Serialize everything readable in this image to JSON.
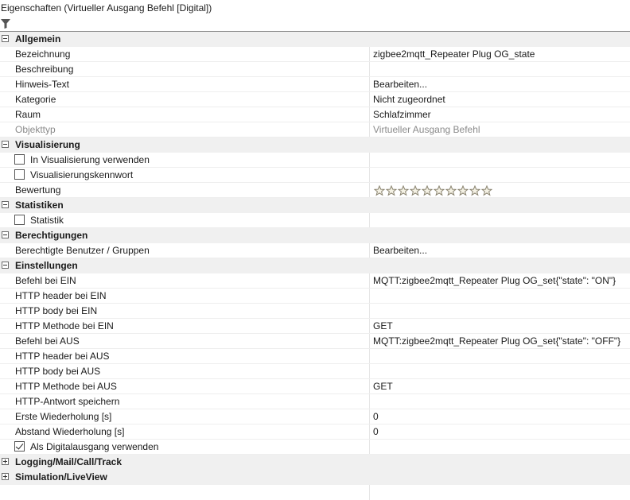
{
  "window": {
    "title": "Eigenschaften (Virtueller Ausgang Befehl [Digital])"
  },
  "toolbar": {
    "filter_icon": "filter-icon"
  },
  "rows": [
    {
      "kind": "category",
      "label": "Allgemein",
      "expanded": true
    },
    {
      "kind": "property",
      "label": "Bezeichnung",
      "value": "zigbee2mqtt_Repeater Plug OG_state"
    },
    {
      "kind": "property",
      "label": "Beschreibung",
      "value": ""
    },
    {
      "kind": "property",
      "label": "Hinweis-Text",
      "value": "Bearbeiten..."
    },
    {
      "kind": "property",
      "label": "Kategorie",
      "value": "Nicht zugeordnet"
    },
    {
      "kind": "property",
      "label": "Raum",
      "value": "Schlafzimmer"
    },
    {
      "kind": "property",
      "label": "Objekttyp",
      "value": "Virtueller Ausgang Befehl",
      "disabled": true
    },
    {
      "kind": "category",
      "label": "Visualisierung",
      "expanded": true
    },
    {
      "kind": "checkbox",
      "label": "In Visualisierung verwenden",
      "checked": false
    },
    {
      "kind": "checkbox",
      "label": "Visualisierungskennwort",
      "checked": false
    },
    {
      "kind": "rating",
      "label": "Bewertung",
      "stars_total": 10,
      "stars_filled": 0
    },
    {
      "kind": "category",
      "label": "Statistiken",
      "expanded": true
    },
    {
      "kind": "checkbox",
      "label": "Statistik",
      "checked": false
    },
    {
      "kind": "category",
      "label": "Berechtigungen",
      "expanded": true
    },
    {
      "kind": "property",
      "label": "Berechtigte Benutzer / Gruppen",
      "value": "Bearbeiten..."
    },
    {
      "kind": "category",
      "label": "Einstellungen",
      "expanded": true
    },
    {
      "kind": "property",
      "label": "Befehl bei EIN",
      "value": "MQTT:zigbee2mqtt_Repeater Plug OG_set{\"state\": \"ON\"}"
    },
    {
      "kind": "property",
      "label": "HTTP header bei EIN",
      "value": ""
    },
    {
      "kind": "property",
      "label": "HTTP body bei EIN",
      "value": ""
    },
    {
      "kind": "property",
      "label": "HTTP Methode bei EIN",
      "value": "GET"
    },
    {
      "kind": "property",
      "label": "Befehl bei AUS",
      "value": "MQTT:zigbee2mqtt_Repeater Plug OG_set{\"state\": \"OFF\"}"
    },
    {
      "kind": "property",
      "label": "HTTP header bei AUS",
      "value": ""
    },
    {
      "kind": "property",
      "label": "HTTP body bei AUS",
      "value": ""
    },
    {
      "kind": "property",
      "label": "HTTP Methode bei AUS",
      "value": "GET"
    },
    {
      "kind": "property",
      "label": "HTTP-Antwort speichern",
      "value": ""
    },
    {
      "kind": "property",
      "label": "Erste Wiederholung [s]",
      "value": "0"
    },
    {
      "kind": "property",
      "label": "Abstand Wiederholung [s]",
      "value": "0"
    },
    {
      "kind": "checkbox",
      "label": "Als Digitalausgang verwenden",
      "checked": true
    },
    {
      "kind": "category",
      "label": "Logging/Mail/Call/Track",
      "expanded": false
    },
    {
      "kind": "category",
      "label": "Simulation/LiveView",
      "expanded": false
    }
  ]
}
